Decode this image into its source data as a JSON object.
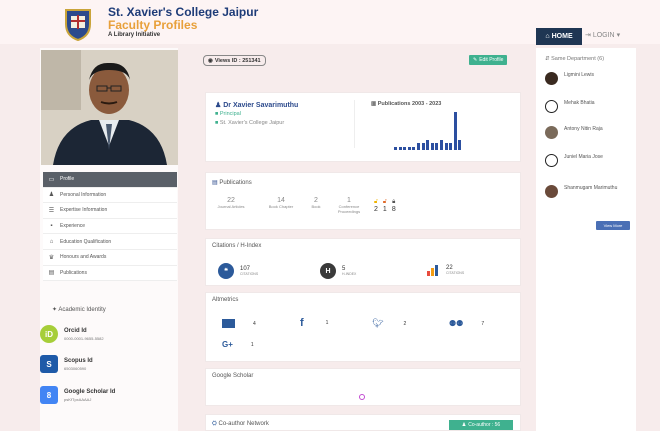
{
  "header": {
    "brand_line1": "St. Xavier's College Jaipur",
    "brand_line2": "Faculty Profiles",
    "brand_line3": "A Library Initiative",
    "nav_home": "HOME",
    "nav_login": "LOGIN"
  },
  "profile": {
    "views_label": "Views ID : 251341",
    "edit_label": "Edit Profile",
    "name": "Dr Xavier Savarimuthu",
    "role": "Principal",
    "institution": "St. Xavier's College Jaipur"
  },
  "publications_chart": {
    "title": "Publications 2003 - 2023"
  },
  "chart_data": {
    "type": "bar",
    "title": "Publications 2003 - 2023",
    "values": [
      1,
      1,
      1,
      1,
      1,
      2,
      2,
      3,
      2,
      2,
      3,
      2,
      2,
      11,
      3
    ]
  },
  "sidebar_menu": [
    {
      "icon": "monitor-icon",
      "label": "Profile",
      "active": true
    },
    {
      "icon": "user-icon",
      "label": "Personal Information",
      "active": false
    },
    {
      "icon": "list-icon",
      "label": "Expertise Information",
      "active": false
    },
    {
      "icon": "briefcase-icon",
      "label": "Experience",
      "active": false
    },
    {
      "icon": "graduation-cap-icon",
      "label": "Education Qualification",
      "active": false
    },
    {
      "icon": "trophy-icon",
      "label": "Honours and Awards",
      "active": false
    },
    {
      "icon": "book-icon",
      "label": "Publications",
      "active": false
    }
  ],
  "academic": {
    "title": "Academic Identity",
    "orcid_label": "Orcid Id",
    "orcid_value": "0000-0001-9655-5582",
    "scopus_label": "Scopus Id",
    "scopus_value": "6503060590",
    "scholar_label": "Google Scholar Id",
    "scholar_value": "psKfTpxAAAAJ"
  },
  "publications_card": {
    "title": "Publications",
    "journal_count": "22",
    "journal_label": "Journal Articles",
    "chapter_count": "14",
    "chapter_label": "Book Chapter",
    "book_count": "2",
    "book_label": "Book",
    "conf_count": "1",
    "conf_label": "Conference Proceedings",
    "lock_counts": [
      "2",
      "1",
      "8"
    ]
  },
  "citations": {
    "title": "Citations / H-Index",
    "citations_value": "107",
    "citations_label": "CITATIONS",
    "hindex_value": "5",
    "hindex_label": "H-INDEX",
    "gs_value": "22",
    "gs_label": "CITATIONS"
  },
  "altmetrics": {
    "title": "Altmetrics",
    "items": [
      {
        "icon": "mendeley-icon",
        "value": "4"
      },
      {
        "icon": "facebook-icon",
        "value": "1"
      },
      {
        "icon": "twitter-icon",
        "value": "2"
      },
      {
        "icon": "people-icon",
        "value": "7"
      },
      {
        "icon": "google-plus-icon",
        "value": "1"
      }
    ]
  },
  "scholar_card": {
    "title": "Google Scholar"
  },
  "network_card": {
    "title": "Co-author Network",
    "button": "Co-author : 56"
  },
  "right_panel": {
    "title": "Same Department (6)",
    "view_more": "View More",
    "coauthors": [
      "Ligmini Lewis",
      "Mehak Bhatia",
      "Antony Nitin Raja",
      "Juniel Maria Jose",
      "Shanmugam Marimuthu"
    ]
  },
  "colors": {
    "brand_blue": "#1e3c78",
    "brand_orange": "#e8a03a",
    "nav_dark": "#1f3653",
    "accent_green": "#3fb18f",
    "bar_blue": "#2c4fa0"
  }
}
